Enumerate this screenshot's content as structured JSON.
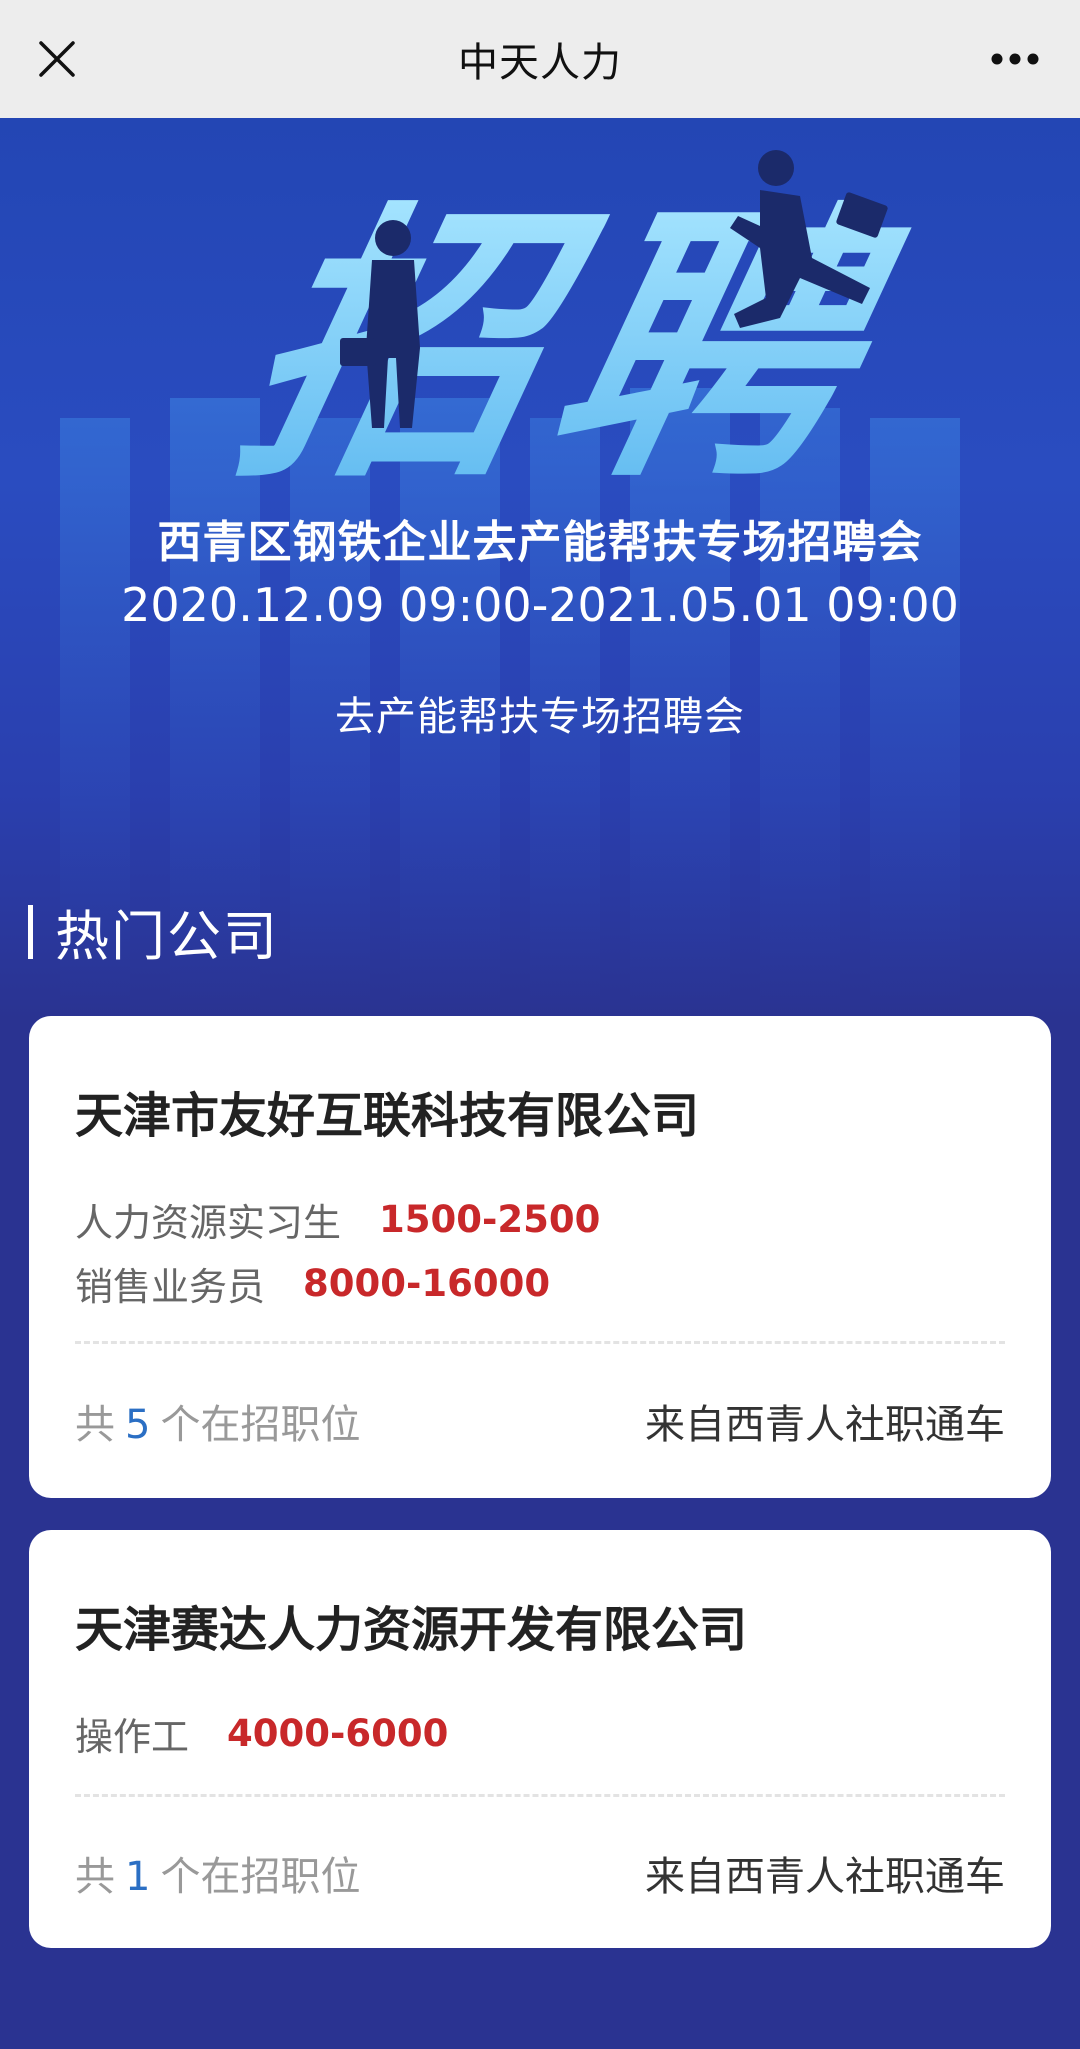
{
  "topbar": {
    "title": "中天人力",
    "close_icon": "close-icon",
    "more_icon": "more-icon"
  },
  "banner": {
    "hero_text": "招聘",
    "event_title": "西青区钢铁企业去产能帮扶专场招聘会",
    "event_dates": "2020.12.09 09:00-2021.05.01 09:00",
    "event_subtitle": "去产能帮扶专场招聘会"
  },
  "section": {
    "title": "热门公司"
  },
  "companies": [
    {
      "name": "天津市友好互联科技有限公司",
      "jobs": [
        {
          "title": "人力资源实习生",
          "salary": "1500-2500"
        },
        {
          "title": "销售业务员",
          "salary": "8000-16000"
        }
      ],
      "count_prefix": "共",
      "count": "5",
      "count_suffix": "个在招职位",
      "source": "来自西青人社职通车"
    },
    {
      "name": "天津赛达人力资源开发有限公司",
      "jobs": [
        {
          "title": "操作工",
          "salary": "4000-6000"
        }
      ],
      "count_prefix": "共",
      "count": "1",
      "count_suffix": "个在招职位",
      "source": "来自西青人社职通车"
    }
  ],
  "colors": {
    "topbar_bg": "#ededed",
    "banner_blue": "#2a4cc0",
    "page_bg": "#2a3391",
    "salary_red": "#c8282a",
    "count_blue": "#2b6fc4"
  }
}
